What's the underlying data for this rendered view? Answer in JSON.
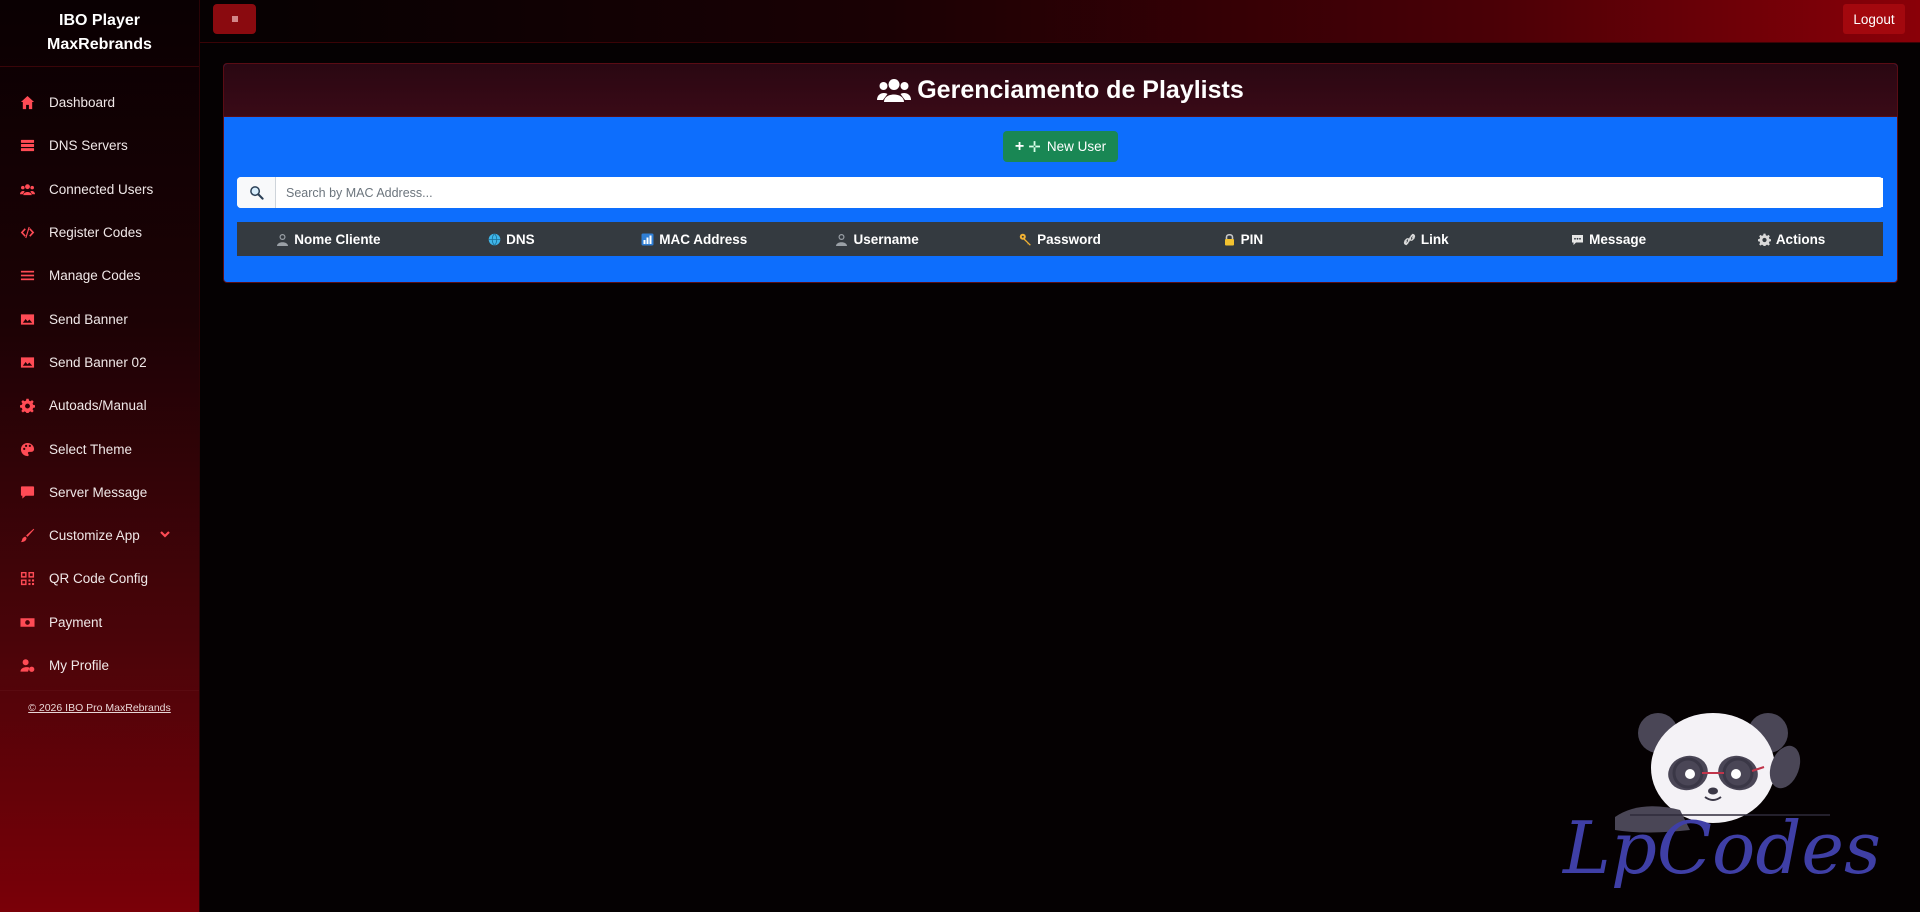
{
  "sidebar": {
    "brand_line1": "IBO Player",
    "brand_line2": "MaxRebrands",
    "items": [
      {
        "label": "Dashboard",
        "icon": "home-icon"
      },
      {
        "label": "DNS Servers",
        "icon": "server-icon"
      },
      {
        "label": "Connected Users",
        "icon": "users-icon"
      },
      {
        "label": "Register Codes",
        "icon": "code-icon"
      },
      {
        "label": "Manage Codes",
        "icon": "list-icon"
      },
      {
        "label": "Send Banner",
        "icon": "image-icon"
      },
      {
        "label": "Send Banner 02",
        "icon": "image-icon"
      },
      {
        "label": "Autoads/Manual",
        "icon": "gear-icon"
      },
      {
        "label": "Select Theme",
        "icon": "palette-icon"
      },
      {
        "label": "Server Message",
        "icon": "message-icon"
      },
      {
        "label": "Customize App",
        "icon": "brush-icon"
      },
      {
        "label": "QR Code Config",
        "icon": "qrcode-icon"
      },
      {
        "label": "Payment",
        "icon": "money-icon"
      },
      {
        "label": "My Profile",
        "icon": "user-gear-icon"
      }
    ],
    "footer": "© 2026 IBO Pro MaxRebrands"
  },
  "topbar": {
    "logout_label": "Logout"
  },
  "main": {
    "title": "Gerenciamento de Playlists",
    "new_user_label": "New User",
    "search_placeholder": "Search by MAC Address...",
    "columns": [
      {
        "label": "Nome Cliente",
        "icon": "person-icon"
      },
      {
        "label": "DNS",
        "icon": "globe-icon"
      },
      {
        "label": "MAC Address",
        "icon": "chart-icon"
      },
      {
        "label": "Username",
        "icon": "person-icon"
      },
      {
        "label": "Password",
        "icon": "key-icon"
      },
      {
        "label": "PIN",
        "icon": "lock-icon"
      },
      {
        "label": "Link",
        "icon": "link-icon"
      },
      {
        "label": "Message",
        "icon": "speech-bubble-icon"
      },
      {
        "label": "Actions",
        "icon": "gear-icon"
      }
    ]
  },
  "colors": {
    "accent": "#ff4b55",
    "card_body": "#0d6efd",
    "new_user": "#198754",
    "table_head": "#343a40",
    "logout": "#a3080e"
  },
  "watermark_text": "LpCodes"
}
